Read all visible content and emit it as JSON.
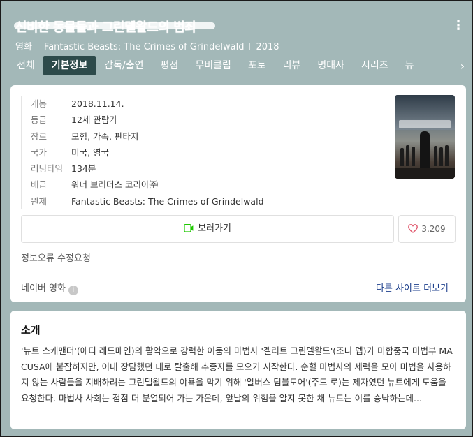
{
  "header": {
    "title": "신비한 동물들과 그린델왈드의 범죄",
    "more_icon": "more-vertical-icon",
    "category": "영화",
    "original_title": "Fantastic Beasts: The Crimes of Grindelwald",
    "year": "2018"
  },
  "tabs": [
    {
      "label": "전체"
    },
    {
      "label": "기본정보",
      "active": true
    },
    {
      "label": "감독/출연"
    },
    {
      "label": "평점"
    },
    {
      "label": "무비클립"
    },
    {
      "label": "포토"
    },
    {
      "label": "리뷰"
    },
    {
      "label": "명대사"
    },
    {
      "label": "시리즈"
    },
    {
      "label": "뉴"
    }
  ],
  "tab_arrow_icon": "chevron-right-icon",
  "info": {
    "rows": [
      {
        "label": "개봉",
        "value": "2018.11.14."
      },
      {
        "label": "등급",
        "value": "12세 관람가"
      },
      {
        "label": "장르",
        "value": "모험, 가족, 판타지"
      },
      {
        "label": "국가",
        "value": "미국, 영국"
      },
      {
        "label": "러닝타임",
        "value": "134분"
      },
      {
        "label": "배급",
        "value": "워너 브러더스 코리아㈜"
      },
      {
        "label": "원제",
        "value": "Fantastic Beasts: The Crimes of Grindelwald"
      }
    ],
    "watch_label": "보러가기",
    "like_count": "3,209",
    "fix_request": "정보오류 수정요청",
    "source_label": "네이버 영화",
    "other_sites": "다른 사이트 더보기"
  },
  "synopsis": {
    "title": "소개",
    "text": "'뉴트 스캐맨더'(에디 레드메인)의 활약으로 강력한 어둠의 마법사 '겔러트 그린델왈드'(조니 뎁)가 미합중국 마법부 MACUSA에 붙잡히지만, 이내 장담했던 대로 탈출해 추종자를 모으기 시작한다. 순혈 마법사의 세력을 모아 마법을 사용하지 않는 사람들을 지배하려는 그린델왈드의 야욕을 막기 위해 '알버스 덤블도어'(주드 로)는 제자였던 뉴트에게 도움을 요청한다. 마법사 사회는 점점 더 분열되어 가는 가운데, 앞날의 위험을 알지 못한 채 뉴트는 이를 승낙하는데..."
  },
  "colors": {
    "header_bg": "#a3b8b8",
    "active_tab_bg": "#2d4a4a",
    "link_blue": "#1c3f8c",
    "play_green": "#1ec800",
    "heart_red": "#e0556b"
  }
}
